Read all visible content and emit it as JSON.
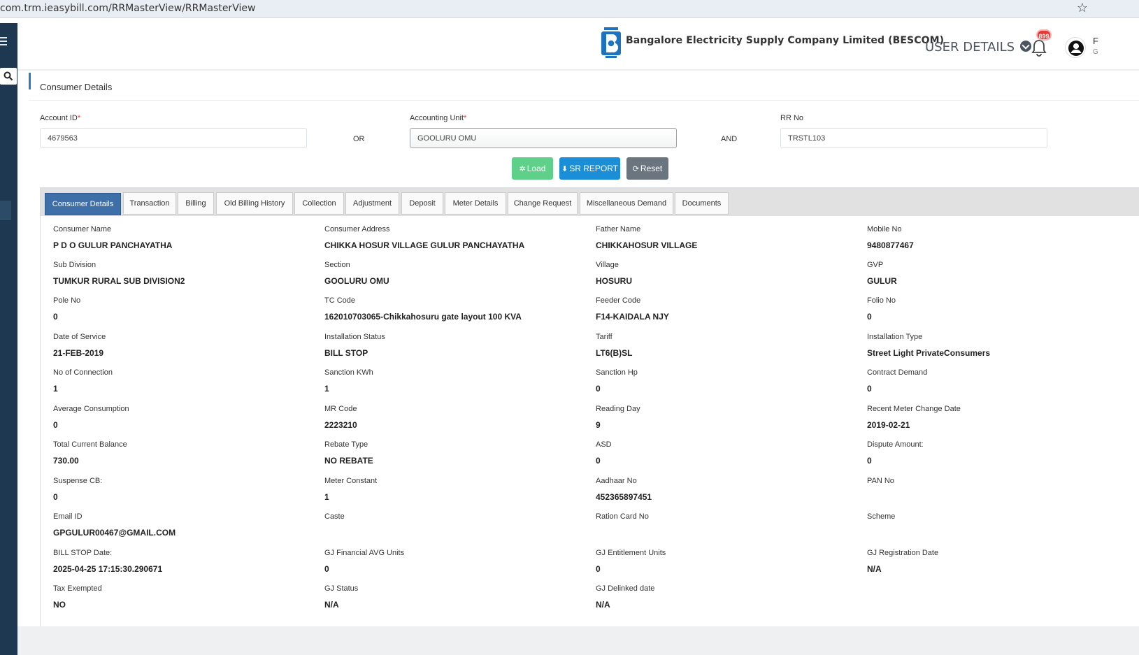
{
  "browser": {
    "url": "com.trm.ieasybill.com/RRMasterView/RRMasterView"
  },
  "header": {
    "company": "Bangalore Electricity Supply Company Limited (BESCOM)",
    "user_details": "USER DETAILS",
    "notification_count": "899",
    "user_initial": "F",
    "user_sub": "G"
  },
  "section": {
    "title": "Consumer Details"
  },
  "form": {
    "account_id_label": "Account ID",
    "account_id_value": "4679563",
    "or": "OR",
    "accounting_unit_label": "Accounting Unit",
    "accounting_unit_value": "GOOLURU OMU",
    "and": "AND",
    "rr_label": "RR No",
    "rr_value": "TRSTL103",
    "required_mark": "*"
  },
  "buttons": {
    "load": "Load",
    "sr_report": "SR REPORT",
    "reset": "Reset"
  },
  "tabs": [
    "Consumer Details",
    "Transaction",
    "Billing",
    "Old Billing History",
    "Collection",
    "Adjustment",
    "Deposit",
    "Meter Details",
    "Change Request",
    "Miscellaneous Demand",
    "Documents"
  ],
  "fields": [
    [
      {
        "label": "Consumer Name",
        "value": "P D O GULUR PANCHAYATHA"
      },
      {
        "label": "Consumer Address",
        "value": "CHIKKA HOSUR VILLAGE GULUR PANCHAYATHA"
      },
      {
        "label": "Father Name",
        "value": "CHIKKAHOSUR VILLAGE"
      },
      {
        "label": "Mobile No",
        "value": "9480877467"
      }
    ],
    [
      {
        "label": "Sub Division",
        "value": "TUMKUR RURAL SUB DIVISION2"
      },
      {
        "label": "Section",
        "value": "GOOLURU OMU"
      },
      {
        "label": "Village",
        "value": "HOSURU"
      },
      {
        "label": "GVP",
        "value": "GULUR"
      }
    ],
    [
      {
        "label": "Pole No",
        "value": "0"
      },
      {
        "label": "TC Code",
        "value": "162010703065-Chikkahosuru gate layout 100 KVA"
      },
      {
        "label": "Feeder Code",
        "value": "F14-KAIDALA NJY"
      },
      {
        "label": "Folio No",
        "value": "0"
      }
    ],
    [
      {
        "label": "Date of Service",
        "value": "21-FEB-2019"
      },
      {
        "label": "Installation Status",
        "value": "BILL STOP"
      },
      {
        "label": "Tariff",
        "value": "LT6(B)SL"
      },
      {
        "label": "Installation Type",
        "value": "Street Light PrivateConsumers"
      }
    ],
    [
      {
        "label": "No of Connection",
        "value": "1"
      },
      {
        "label": "Sanction KWh",
        "value": "1"
      },
      {
        "label": "Sanction Hp",
        "value": "0"
      },
      {
        "label": "Contract Demand",
        "value": "0"
      }
    ],
    [
      {
        "label": "Average Consumption",
        "value": "0"
      },
      {
        "label": "MR Code",
        "value": "2223210"
      },
      {
        "label": "Reading Day",
        "value": "9"
      },
      {
        "label": "Recent Meter Change Date",
        "value": "2019-02-21"
      }
    ],
    [
      {
        "label": "Total Current Balance",
        "value": "730.00"
      },
      {
        "label": "Rebate Type",
        "value": "NO REBATE"
      },
      {
        "label": "ASD",
        "value": "0"
      },
      {
        "label": "Dispute Amount:",
        "value": "0"
      }
    ],
    [
      {
        "label": "Suspense CB:",
        "value": "0"
      },
      {
        "label": "Meter Constant",
        "value": "1"
      },
      {
        "label": "Aadhaar No",
        "value": "452365897451"
      },
      {
        "label": "PAN No",
        "value": ""
      }
    ],
    [
      {
        "label": "Email ID",
        "value": "GPGULUR00467@GMAIL.COM"
      },
      {
        "label": "Caste",
        "value": ""
      },
      {
        "label": "Ration Card No",
        "value": ""
      },
      {
        "label": "Scheme",
        "value": ""
      }
    ],
    [
      {
        "label": "BILL STOP Date:",
        "value": "2025-04-25 17:15:30.290671"
      },
      {
        "label": "GJ Financial AVG Units",
        "value": "0"
      },
      {
        "label": "GJ Entitlement Units",
        "value": "0"
      },
      {
        "label": "GJ Registration Date",
        "value": "N/A"
      }
    ],
    [
      {
        "label": "Tax Exempted",
        "value": "NO"
      },
      {
        "label": "GJ Status",
        "value": "N/A"
      },
      {
        "label": "GJ Delinked date",
        "value": "N/A"
      }
    ]
  ]
}
